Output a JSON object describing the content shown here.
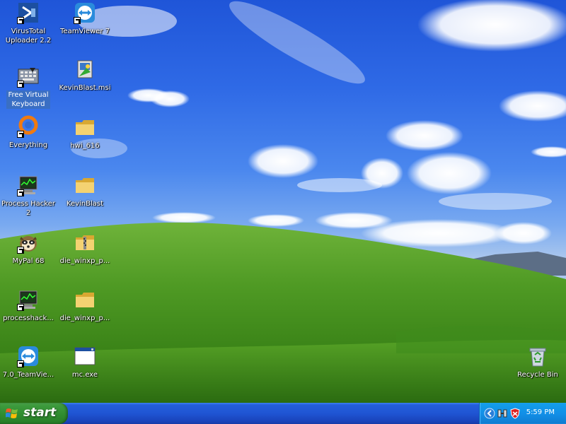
{
  "desktop": {
    "icons": [
      {
        "label_line1": "VirusTotal",
        "label_line2": "Uploader 2.2",
        "icon": "virustotal-icon"
      },
      {
        "label_line1": "TeamViewer 7",
        "icon": "teamviewer-icon"
      },
      {
        "label_line1": "Free Virtual",
        "label_line2": "Keyboard",
        "icon": "keyboard-icon",
        "selected": true
      },
      {
        "label_line1": "KevinBlast.msi",
        "icon": "installer-icon"
      },
      {
        "label_line1": "Everything",
        "icon": "everything-icon"
      },
      {
        "label_line1": "hwi_616",
        "icon": "folder-icon"
      },
      {
        "label_line1": "Process Hacker",
        "label_line2": "2",
        "icon": "process-hacker-icon"
      },
      {
        "label_line1": "KevinBlast",
        "icon": "folder-icon"
      },
      {
        "label_line1": "MyPal 68",
        "icon": "mypal-icon"
      },
      {
        "label_line1": "die_winxp_p...",
        "icon": "zip-folder-icon"
      },
      {
        "label_line1": "processhack...",
        "icon": "process-hacker-icon"
      },
      {
        "label_line1": "die_winxp_p...",
        "icon": "folder-icon"
      },
      {
        "label_line1": "7.0_TeamVie...",
        "icon": "teamviewer-icon"
      },
      {
        "label_line1": "mc.exe",
        "icon": "exe-window-icon"
      },
      {
        "label_line1": "Recycle Bin",
        "icon": "recycle-bin-icon"
      }
    ]
  },
  "taskbar": {
    "start_label": "start",
    "tray_icons": [
      "chevron-left-icon",
      "network-icon",
      "security-shield-icon"
    ],
    "clock": "5:59 PM"
  },
  "colors": {
    "taskbar_blue": "#245edb",
    "start_green": "#2f8b2f",
    "tray_blue": "#1290e8"
  }
}
